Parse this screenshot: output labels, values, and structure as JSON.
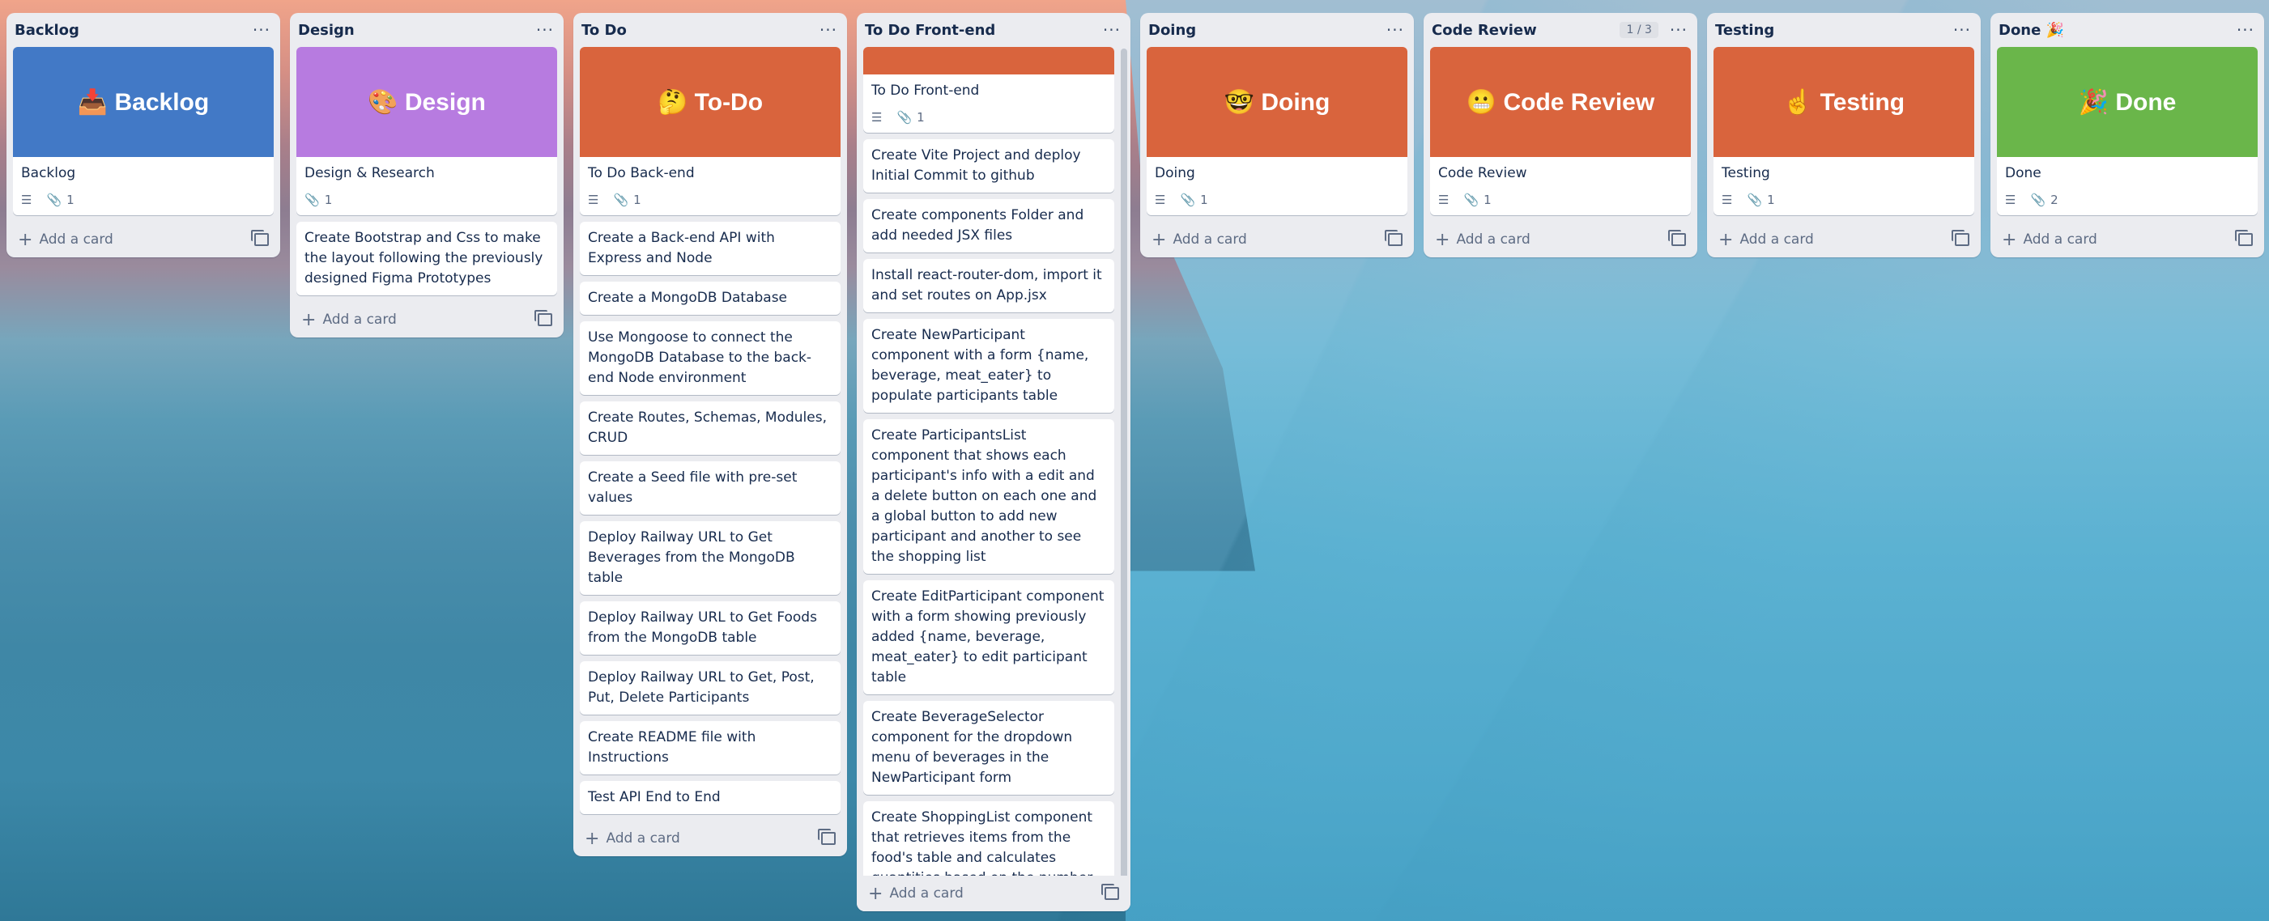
{
  "colors": {
    "blue": "#4279c6",
    "purple": "#b77be0",
    "orange": "#d9643d",
    "green": "#6ab64a"
  },
  "add_card_label": "Add a card",
  "lists": [
    {
      "title": "Backlog",
      "cover_text": "📥 Backlog",
      "cover_card_title": "Backlog",
      "attachments": "1",
      "cards": []
    },
    {
      "title": "Design",
      "cover_text": "🎨 Design",
      "cover_card_title": "Design & Research",
      "attachments": "1",
      "cards": [
        "Create Bootstrap and Css to make the layout following the previously designed Figma Prototypes"
      ]
    },
    {
      "title": "To Do",
      "cover_text": "🤔 To-Do",
      "cover_card_title": "To Do Back-end",
      "attachments": "1",
      "cards": [
        "Create a Back-end API with Express and Node",
        "Create a MongoDB Database",
        "Use Mongoose to connect the MongoDB Database to the back-end Node environment",
        "Create Routes, Schemas, Modules, CRUD",
        "Create a Seed file with pre-set values",
        "Deploy Railway URL to Get Beverages from the MongoDB table",
        "Deploy Railway URL to Get Foods from the MongoDB table",
        "Deploy Railway URL to Get, Post, Put, Delete Participants",
        "Create README file with Instructions",
        "Test API End to End"
      ]
    },
    {
      "title": "To Do Front-end",
      "cover_card_title": "To Do Front-end",
      "attachments": "1",
      "cards": [
        "Create Vite Project and deploy Initial Commit to github",
        "Create components Folder and add needed JSX files",
        "Install react-router-dom, import it and set routes on App.jsx",
        "Create NewParticipant component with a form {name, beverage, meat_eater} to populate participants table",
        "Create ParticipantsList component that shows each participant's info with a edit and a delete button on each one and a global button to add new participant and another to see the shopping list",
        "Create EditParticipant component with a form showing previously added {name, beverage, meat_eater} to edit participant table",
        "Create BeverageSelector component for the dropdown menu of beverages in the NewParticipant form",
        "Create ShoppingList component that retrieves items from the food's table and calculates quantities based on the number of participants, what they drink, if the eat meat or not."
      ]
    },
    {
      "title": "Doing",
      "cover_text": "🤓 Doing",
      "cover_card_title": "Doing",
      "attachments": "1",
      "cards": []
    },
    {
      "title": "Code Review",
      "badge": "1 / 3",
      "cover_text": "😬 Code Review",
      "cover_card_title": "Code Review",
      "attachments": "1",
      "cards": []
    },
    {
      "title": "Testing",
      "cover_text": "☝️ Testing",
      "cover_card_title": "Testing",
      "attachments": "1",
      "cards": []
    },
    {
      "title": "Done 🎉",
      "cover_text": "🎉 Done",
      "cover_card_title": "Done",
      "attachments": "2",
      "cards": []
    }
  ]
}
